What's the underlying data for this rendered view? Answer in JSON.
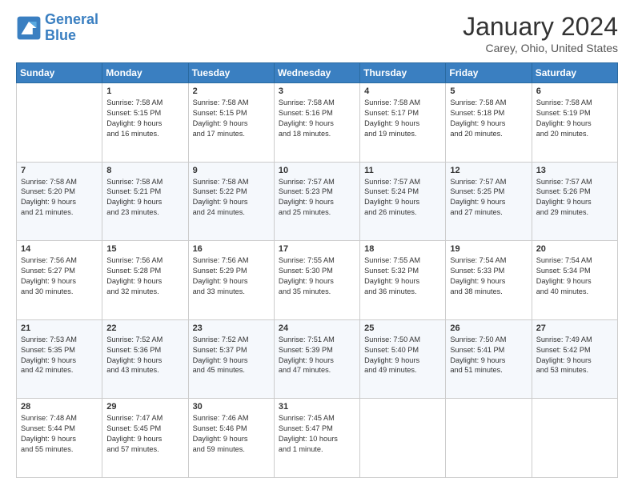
{
  "logo": {
    "line1": "General",
    "line2": "Blue"
  },
  "title": "January 2024",
  "subtitle": "Carey, Ohio, United States",
  "days_header": [
    "Sunday",
    "Monday",
    "Tuesday",
    "Wednesday",
    "Thursday",
    "Friday",
    "Saturday"
  ],
  "weeks": [
    [
      {
        "num": "",
        "info": ""
      },
      {
        "num": "1",
        "info": "Sunrise: 7:58 AM\nSunset: 5:15 PM\nDaylight: 9 hours\nand 16 minutes."
      },
      {
        "num": "2",
        "info": "Sunrise: 7:58 AM\nSunset: 5:15 PM\nDaylight: 9 hours\nand 17 minutes."
      },
      {
        "num": "3",
        "info": "Sunrise: 7:58 AM\nSunset: 5:16 PM\nDaylight: 9 hours\nand 18 minutes."
      },
      {
        "num": "4",
        "info": "Sunrise: 7:58 AM\nSunset: 5:17 PM\nDaylight: 9 hours\nand 19 minutes."
      },
      {
        "num": "5",
        "info": "Sunrise: 7:58 AM\nSunset: 5:18 PM\nDaylight: 9 hours\nand 20 minutes."
      },
      {
        "num": "6",
        "info": "Sunrise: 7:58 AM\nSunset: 5:19 PM\nDaylight: 9 hours\nand 20 minutes."
      }
    ],
    [
      {
        "num": "7",
        "info": "Sunrise: 7:58 AM\nSunset: 5:20 PM\nDaylight: 9 hours\nand 21 minutes."
      },
      {
        "num": "8",
        "info": "Sunrise: 7:58 AM\nSunset: 5:21 PM\nDaylight: 9 hours\nand 23 minutes."
      },
      {
        "num": "9",
        "info": "Sunrise: 7:58 AM\nSunset: 5:22 PM\nDaylight: 9 hours\nand 24 minutes."
      },
      {
        "num": "10",
        "info": "Sunrise: 7:57 AM\nSunset: 5:23 PM\nDaylight: 9 hours\nand 25 minutes."
      },
      {
        "num": "11",
        "info": "Sunrise: 7:57 AM\nSunset: 5:24 PM\nDaylight: 9 hours\nand 26 minutes."
      },
      {
        "num": "12",
        "info": "Sunrise: 7:57 AM\nSunset: 5:25 PM\nDaylight: 9 hours\nand 27 minutes."
      },
      {
        "num": "13",
        "info": "Sunrise: 7:57 AM\nSunset: 5:26 PM\nDaylight: 9 hours\nand 29 minutes."
      }
    ],
    [
      {
        "num": "14",
        "info": "Sunrise: 7:56 AM\nSunset: 5:27 PM\nDaylight: 9 hours\nand 30 minutes."
      },
      {
        "num": "15",
        "info": "Sunrise: 7:56 AM\nSunset: 5:28 PM\nDaylight: 9 hours\nand 32 minutes."
      },
      {
        "num": "16",
        "info": "Sunrise: 7:56 AM\nSunset: 5:29 PM\nDaylight: 9 hours\nand 33 minutes."
      },
      {
        "num": "17",
        "info": "Sunrise: 7:55 AM\nSunset: 5:30 PM\nDaylight: 9 hours\nand 35 minutes."
      },
      {
        "num": "18",
        "info": "Sunrise: 7:55 AM\nSunset: 5:32 PM\nDaylight: 9 hours\nand 36 minutes."
      },
      {
        "num": "19",
        "info": "Sunrise: 7:54 AM\nSunset: 5:33 PM\nDaylight: 9 hours\nand 38 minutes."
      },
      {
        "num": "20",
        "info": "Sunrise: 7:54 AM\nSunset: 5:34 PM\nDaylight: 9 hours\nand 40 minutes."
      }
    ],
    [
      {
        "num": "21",
        "info": "Sunrise: 7:53 AM\nSunset: 5:35 PM\nDaylight: 9 hours\nand 42 minutes."
      },
      {
        "num": "22",
        "info": "Sunrise: 7:52 AM\nSunset: 5:36 PM\nDaylight: 9 hours\nand 43 minutes."
      },
      {
        "num": "23",
        "info": "Sunrise: 7:52 AM\nSunset: 5:37 PM\nDaylight: 9 hours\nand 45 minutes."
      },
      {
        "num": "24",
        "info": "Sunrise: 7:51 AM\nSunset: 5:39 PM\nDaylight: 9 hours\nand 47 minutes."
      },
      {
        "num": "25",
        "info": "Sunrise: 7:50 AM\nSunset: 5:40 PM\nDaylight: 9 hours\nand 49 minutes."
      },
      {
        "num": "26",
        "info": "Sunrise: 7:50 AM\nSunset: 5:41 PM\nDaylight: 9 hours\nand 51 minutes."
      },
      {
        "num": "27",
        "info": "Sunrise: 7:49 AM\nSunset: 5:42 PM\nDaylight: 9 hours\nand 53 minutes."
      }
    ],
    [
      {
        "num": "28",
        "info": "Sunrise: 7:48 AM\nSunset: 5:44 PM\nDaylight: 9 hours\nand 55 minutes."
      },
      {
        "num": "29",
        "info": "Sunrise: 7:47 AM\nSunset: 5:45 PM\nDaylight: 9 hours\nand 57 minutes."
      },
      {
        "num": "30",
        "info": "Sunrise: 7:46 AM\nSunset: 5:46 PM\nDaylight: 9 hours\nand 59 minutes."
      },
      {
        "num": "31",
        "info": "Sunrise: 7:45 AM\nSunset: 5:47 PM\nDaylight: 10 hours\nand 1 minute."
      },
      {
        "num": "",
        "info": ""
      },
      {
        "num": "",
        "info": ""
      },
      {
        "num": "",
        "info": ""
      }
    ]
  ]
}
